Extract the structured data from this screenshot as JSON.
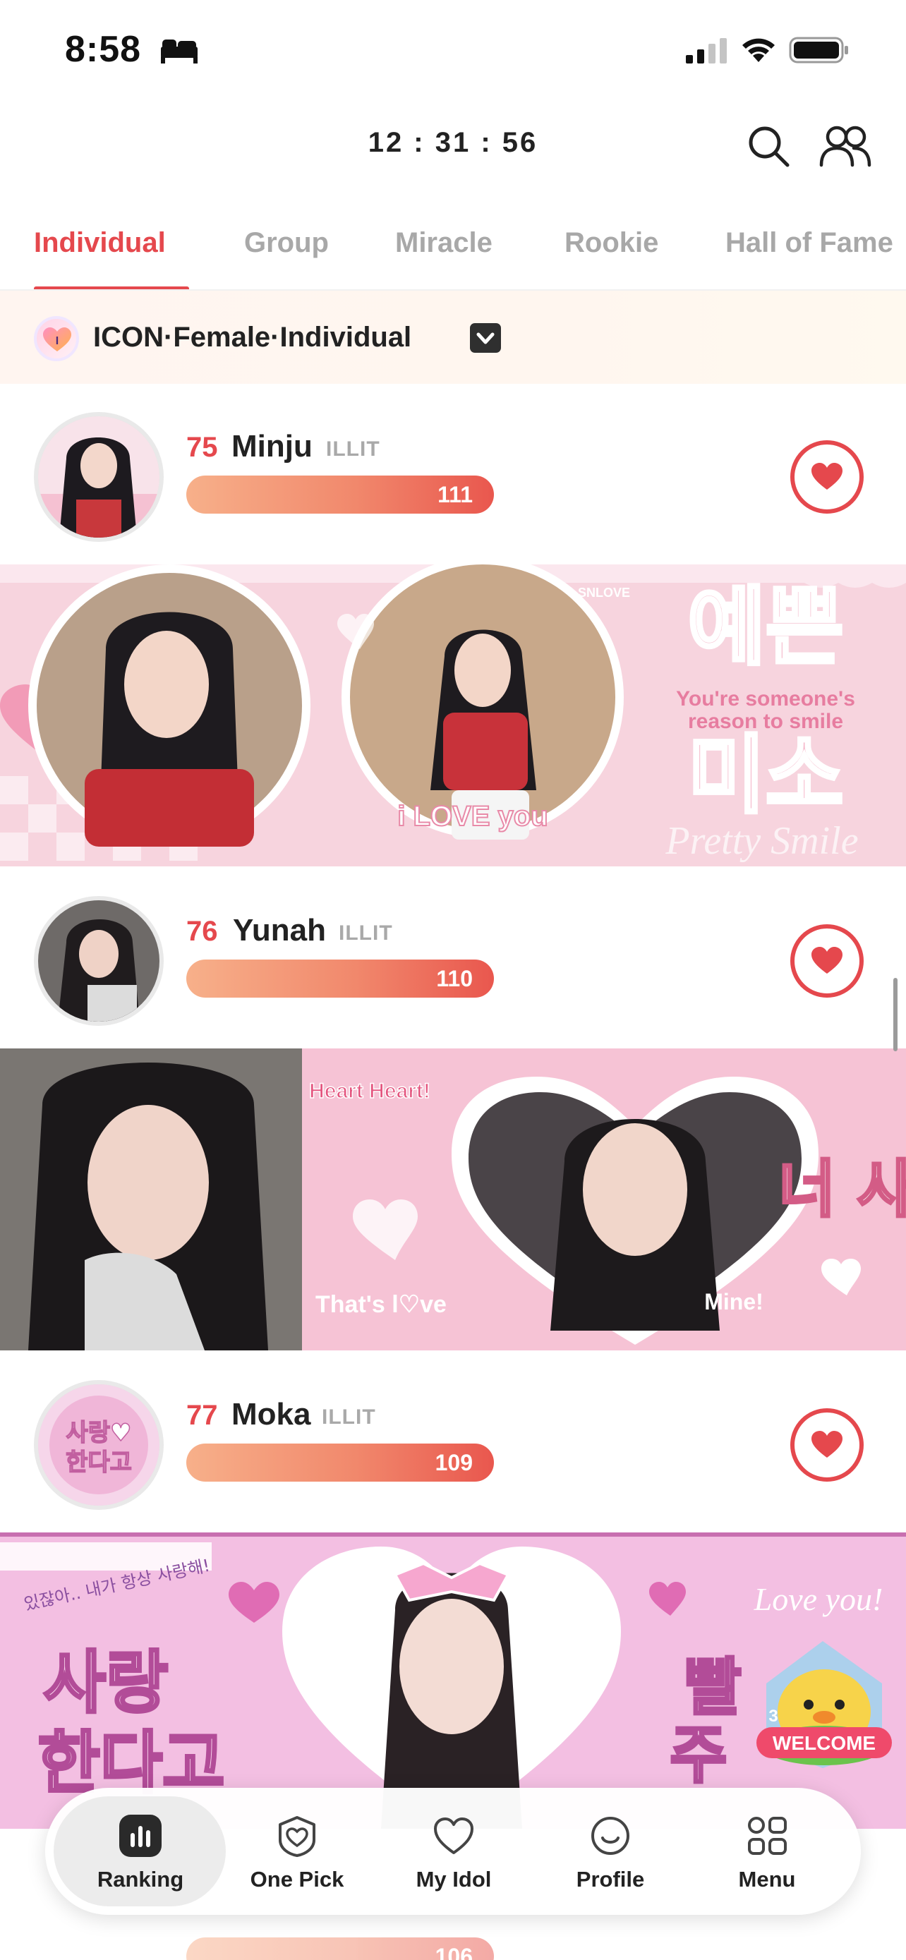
{
  "status_bar": {
    "time": "8:58"
  },
  "header": {
    "timer": "12 : 31 : 56"
  },
  "tabs": [
    {
      "label": "Individual",
      "active": true
    },
    {
      "label": "Group",
      "active": false
    },
    {
      "label": "Miracle",
      "active": false
    },
    {
      "label": "Rookie",
      "active": false
    },
    {
      "label": "Hall of Fame",
      "active": false
    }
  ],
  "category": {
    "badge": "I",
    "label": "ICON·Female·Individual"
  },
  "ranking": [
    {
      "rank": "75",
      "name": "Minju",
      "group": "ILLIT",
      "votes": "111"
    },
    {
      "rank": "76",
      "name": "Yunah",
      "group": "ILLIT",
      "votes": "110"
    },
    {
      "rank": "77",
      "name": "Moka",
      "group": "ILLIT",
      "votes": "109"
    }
  ],
  "banners": {
    "minju": {
      "korean_top": "예쁜",
      "korean_bottom": "미소",
      "tagline_1": "You're someone's",
      "tagline_2": "reason to smile",
      "love_text": "i LOVE you",
      "script_text": "Pretty Smile",
      "small_tag": "SNLOVE"
    },
    "yunah": {
      "heart_text": "Heart Heart!",
      "korean_text": "너 사랑",
      "mine_text": "Mine!",
      "thats_love": "That's l♡ve"
    },
    "moka": {
      "korean_left_1": "사랑",
      "korean_left_2": "한다고",
      "korean_right_1": "빨",
      "korean_right_2": "주",
      "love_you": "Love you!",
      "handwrite": "있잖아.. 내가 항상 사랑해!"
    }
  },
  "next_row_votes": "106",
  "welcome_badge": {
    "label": "WELCOME",
    "count": "3"
  },
  "bottom_nav": [
    {
      "label": "Ranking",
      "icon": "bar-chart-icon",
      "active": true
    },
    {
      "label": "One Pick",
      "icon": "heart-badge-icon",
      "active": false
    },
    {
      "label": "My Idol",
      "icon": "heart-outline-icon",
      "active": false
    },
    {
      "label": "Profile",
      "icon": "smile-face-icon",
      "active": false
    },
    {
      "label": "Menu",
      "icon": "grid-menu-icon",
      "active": false
    }
  ],
  "colors": {
    "accent": "#e5484d",
    "bar_start": "#f7b08a",
    "bar_end": "#e9574e",
    "banner_pink": "#f5c6d6"
  }
}
